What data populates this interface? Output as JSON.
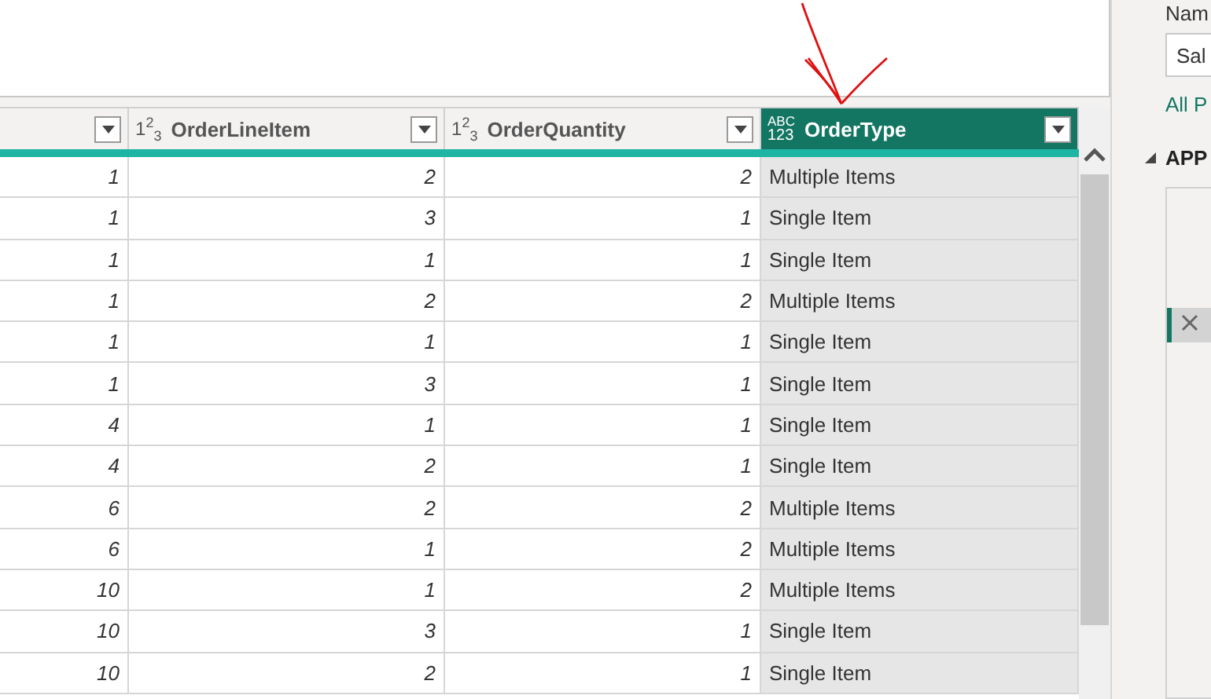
{
  "preview": {
    "kind": "blank"
  },
  "table": {
    "columns": [
      {
        "selected": false
      },
      {
        "title": "OrderLineItem",
        "type_text": [
          "1$^{2}$$_{3}$"
        ],
        "selected": false
      },
      {
        "title": "OrderQuantity",
        "type_text": [
          "1$^{2}$$_{3}$"
        ],
        "selected": false
      },
      {
        "title": "OrderType",
        "type_text": [
          "ABC",
          "123"
        ],
        "selected": true
      }
    ],
    "rows": [
      [
        "1",
        "2",
        "2",
        "Multiple Items"
      ],
      [
        "1",
        "3",
        "1",
        "Single Item"
      ],
      [
        "1",
        "1",
        "1",
        "Single Item"
      ],
      [
        "1",
        "2",
        "2",
        "Multiple Items"
      ],
      [
        "1",
        "1",
        "1",
        "Single Item"
      ],
      [
        "1",
        "3",
        "1",
        "Single Item"
      ],
      [
        "4",
        "1",
        "1",
        "Single Item"
      ],
      [
        "4",
        "2",
        "1",
        "Single Item"
      ],
      [
        "6",
        "2",
        "2",
        "Multiple Items"
      ],
      [
        "6",
        "1",
        "2",
        "Multiple Items"
      ],
      [
        "10",
        "1",
        "2",
        "Multiple Items"
      ],
      [
        "10",
        "3",
        "1",
        "Single Item"
      ],
      [
        "10",
        "2",
        "1",
        "Single Item"
      ]
    ]
  },
  "annotation": {
    "kind": "arrow"
  },
  "panel": {
    "name_label": "Nam",
    "name_value": "Sal",
    "link": "All P",
    "section": {
      "title": "APP",
      "expanded": true,
      "items": [
        {
          "selected": true
        }
      ]
    }
  }
}
